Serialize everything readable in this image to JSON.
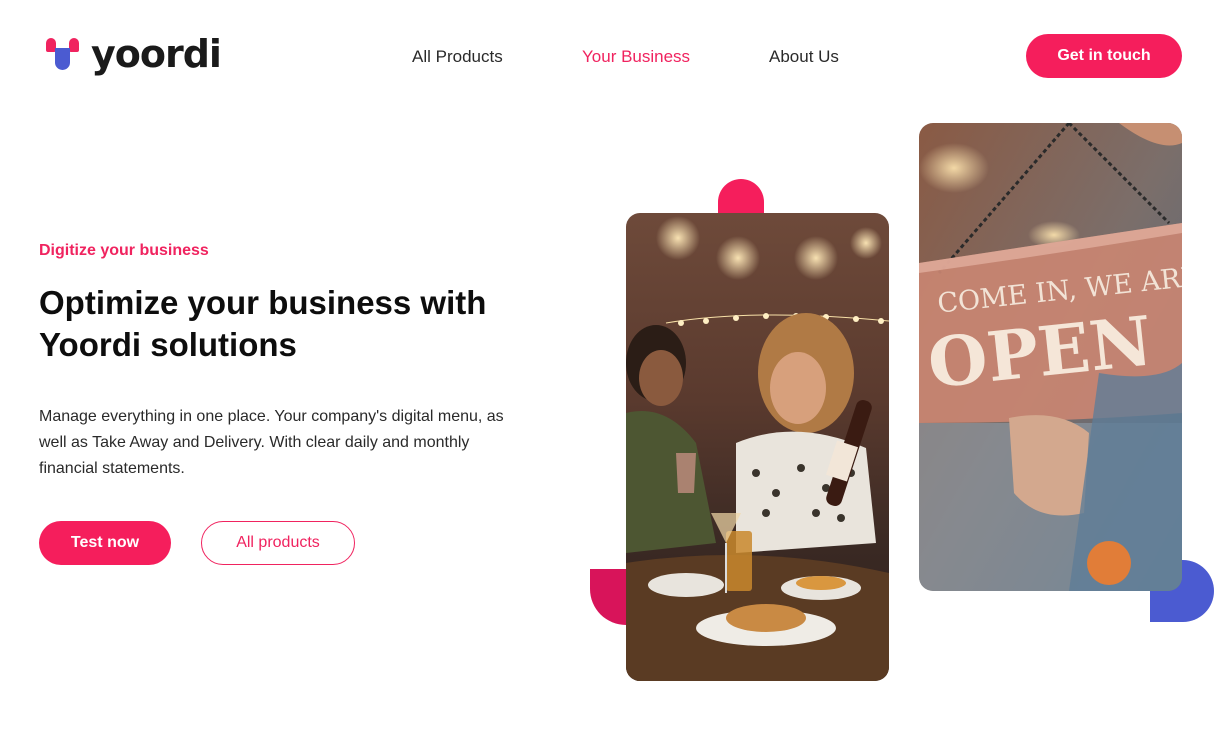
{
  "brand": {
    "name": "yoordi",
    "accent": "#f51e5c",
    "secondary": "#4b5bd1"
  },
  "nav": {
    "items": [
      {
        "label": "All Products",
        "active": false
      },
      {
        "label": "Your Business",
        "active": true
      },
      {
        "label": "About Us",
        "active": false
      }
    ],
    "cta_label": "Get in touch"
  },
  "hero": {
    "eyebrow": "Digitize your business",
    "headline": "Optimize your business with Yoordi solutions",
    "body": "Manage everything in one place. Your company's digital menu, as well as Take Away and Delivery. With clear daily and monthly financial statements.",
    "primary_button": "Test now",
    "secondary_button": "All products"
  },
  "images": {
    "sign_line1": "COME IN, WE ARE",
    "sign_line2": "OPEN"
  }
}
